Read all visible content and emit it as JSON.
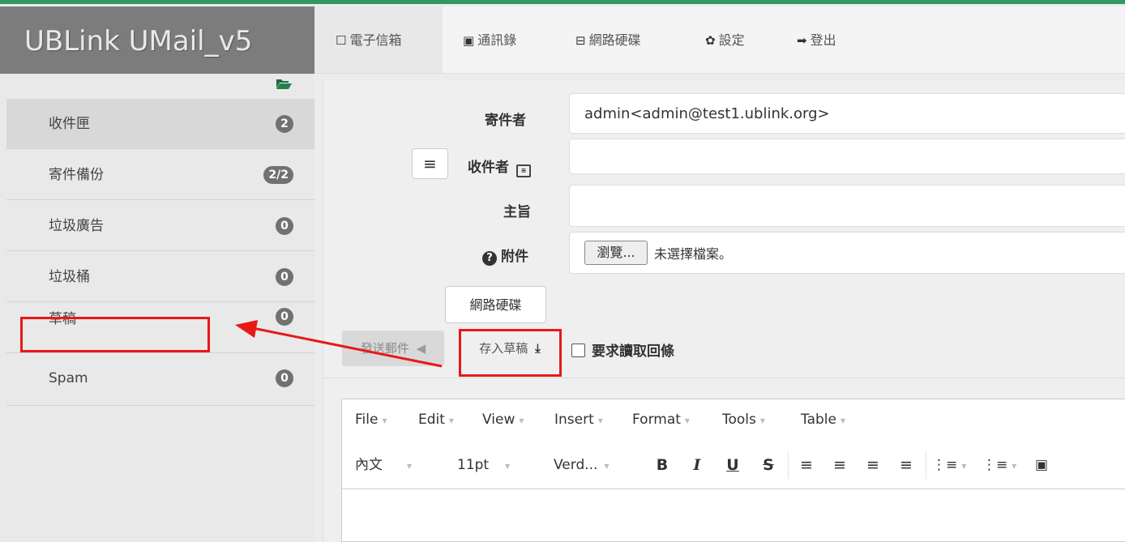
{
  "app": {
    "title": "UBLink UMail_v5"
  },
  "topnav": {
    "items": [
      {
        "label": "電子信箱",
        "icon": "envelope-icon",
        "glyph": "☐",
        "active": true
      },
      {
        "label": "通訊錄",
        "icon": "contact-card-icon",
        "glyph": "▣",
        "active": false
      },
      {
        "label": "網路硬碟",
        "icon": "hard-drive-icon",
        "glyph": "⊟",
        "active": false
      },
      {
        "label": "設定",
        "icon": "gear-icon",
        "glyph": "✿",
        "active": false
      },
      {
        "label": "登出",
        "icon": "logout-icon",
        "glyph": "➡",
        "active": false
      }
    ]
  },
  "sidebar": {
    "items": [
      {
        "label": "收件匣",
        "badge": "2",
        "active": true
      },
      {
        "label": "寄件備份",
        "badge": "2/2",
        "active": false
      },
      {
        "label": "垃圾廣告",
        "badge": "0",
        "active": false
      },
      {
        "label": "垃圾桶",
        "badge": "0",
        "active": false
      },
      {
        "label": "草稿",
        "badge": "0",
        "active": false
      },
      {
        "label": "Spam",
        "badge": "0",
        "active": false
      }
    ]
  },
  "compose": {
    "from_label": "寄件者",
    "from_value": "admin<admin@test1.ublink.org>",
    "to_label": "收件者",
    "to_value": "",
    "subject_label": "主旨",
    "subject_value": "",
    "attach_label": "附件",
    "browse_label": "瀏覽...",
    "no_file_text": "未選擇檔案。",
    "netdisk_label": "網路硬碟",
    "send_label": "發送郵件",
    "save_draft_label": "存入草稿",
    "read_receipt_label": "要求讀取回條",
    "read_receipt_checked": false
  },
  "editor": {
    "menus": [
      "File",
      "Edit",
      "View",
      "Insert",
      "Format",
      "Tools",
      "Table"
    ],
    "block_format": "內文",
    "font_size": "11pt",
    "font_family": "Verd...",
    "tools": {
      "bold": "B",
      "italic": "I",
      "underline": "U",
      "strike": "S",
      "align_left": "≡",
      "align_center": "≡",
      "align_right": "≡",
      "align_justify": "≡",
      "ordered_list": "⋮≡",
      "bullet_list": "⋮≡",
      "image": "▣"
    }
  },
  "colors": {
    "accent": "#2e9a62",
    "annotation": "#e81818",
    "brand_bg": "#7c7c7c",
    "badge_bg": "#717171"
  }
}
